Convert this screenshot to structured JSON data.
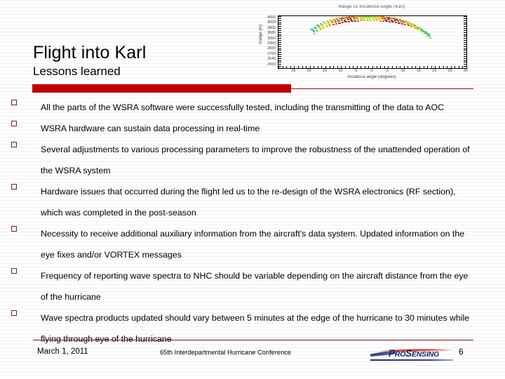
{
  "slide": {
    "title": "Flight into Karl",
    "subtitle": "Lessons learned",
    "accent_color": "#c00000",
    "rule_color": "#7b1b2a",
    "bullet_color": "#7b1b2a"
  },
  "bullets": [
    {
      "text": "All the parts of the WSRA software were successfully tested, including the transmitting of the data to AOC"
    },
    {
      "text": "WSRA hardware can sustain data processing in real-time"
    },
    {
      "text": "Several adjustments to various processing parameters to improve the robustness of the unattended operation of the WSRA system"
    },
    {
      "text": "Hardware issues that occurred during the flight led us to the re-design of the WSRA electronics (RF section), which was completed in the post-season"
    },
    {
      "text": "Necessity to receive additional auxiliary information from the aircraft's data system. Updated information on the eye fixes and/or VORTEX messages"
    },
    {
      "text": "Frequency of reporting wave spectra to NHC should be variable depending on the aircraft distance from the eye of the hurricane"
    },
    {
      "text": "Wave spectra products updated should vary between 5 minutes at the edge of the hurricane to 30 minutes while flying through eye of the hurricane"
    }
  ],
  "footer": {
    "date": "March 1, 2011",
    "conference": "65th Interdepartmental Hurricane Conference",
    "page_number": "6",
    "logo_text_pro": "P",
    "logo_text_ro": "RO",
    "logo_text_s": "S",
    "logo_text_ensing": "ENSING",
    "logo_full": "ProSensing"
  },
  "chart_data": {
    "type": "scatter",
    "title": "Range vs Incidence Angle (Karl)",
    "xlabel": "Incidence angle (degrees)",
    "ylabel": "Range [m]",
    "xlim": [
      -30,
      30
    ],
    "ylim": [
      2400,
      4100
    ],
    "grid": false,
    "legend": "none",
    "xticks": [
      "25",
      "20",
      "15",
      "10",
      "5",
      "0",
      "5",
      "10",
      "15",
      "20",
      "25",
      "30"
    ],
    "xtick_values": [
      -25,
      -20,
      -15,
      -10,
      -5,
      0,
      5,
      10,
      15,
      20,
      25,
      30
    ],
    "yticks": [
      "4050",
      "3920",
      "3800",
      "3680",
      "3050",
      "2950",
      "2820",
      "2700",
      "2540",
      "2410"
    ],
    "ytick_values": [
      4050,
      3920,
      3800,
      3680,
      3050,
      2950,
      2820,
      2700,
      2540,
      2410
    ],
    "x": [
      -19,
      -18,
      -17,
      -16,
      -15,
      -14,
      -13,
      -12,
      -11,
      -10,
      -9,
      -8,
      -7,
      -6,
      -5,
      -4,
      -3,
      -2,
      -1,
      0,
      1,
      2,
      3,
      4,
      5,
      6,
      7,
      8,
      9,
      10,
      11,
      12,
      13,
      14,
      15,
      16,
      17,
      18
    ],
    "y": [
      3640,
      3700,
      3760,
      3810,
      3860,
      3900,
      3935,
      3960,
      3985,
      4005,
      4020,
      4032,
      4042,
      4050,
      4055,
      4058,
      4060,
      4060,
      4060,
      4060,
      4058,
      4055,
      4050,
      4042,
      4032,
      4020,
      4005,
      3985,
      3960,
      3935,
      3900,
      3860,
      3810,
      3760,
      3700,
      3640,
      3570,
      3500
    ],
    "intensity": [
      0.22,
      0.3,
      0.38,
      0.45,
      0.52,
      0.6,
      0.68,
      0.74,
      0.8,
      0.86,
      0.9,
      0.93,
      0.95,
      0.84,
      0.72,
      0.6,
      0.5,
      0.45,
      0.44,
      0.45,
      0.5,
      0.6,
      0.72,
      0.84,
      0.95,
      0.93,
      0.9,
      0.86,
      0.8,
      0.74,
      0.68,
      0.6,
      0.52,
      0.45,
      0.38,
      0.3,
      0.24,
      0.2
    ],
    "colormap": [
      "#2f8fd0",
      "#35c2c2",
      "#3fcf85",
      "#7fd84a",
      "#cfdc33",
      "#e8c02c",
      "#e08a28",
      "#c25a2a",
      "#8f3c2e"
    ]
  }
}
